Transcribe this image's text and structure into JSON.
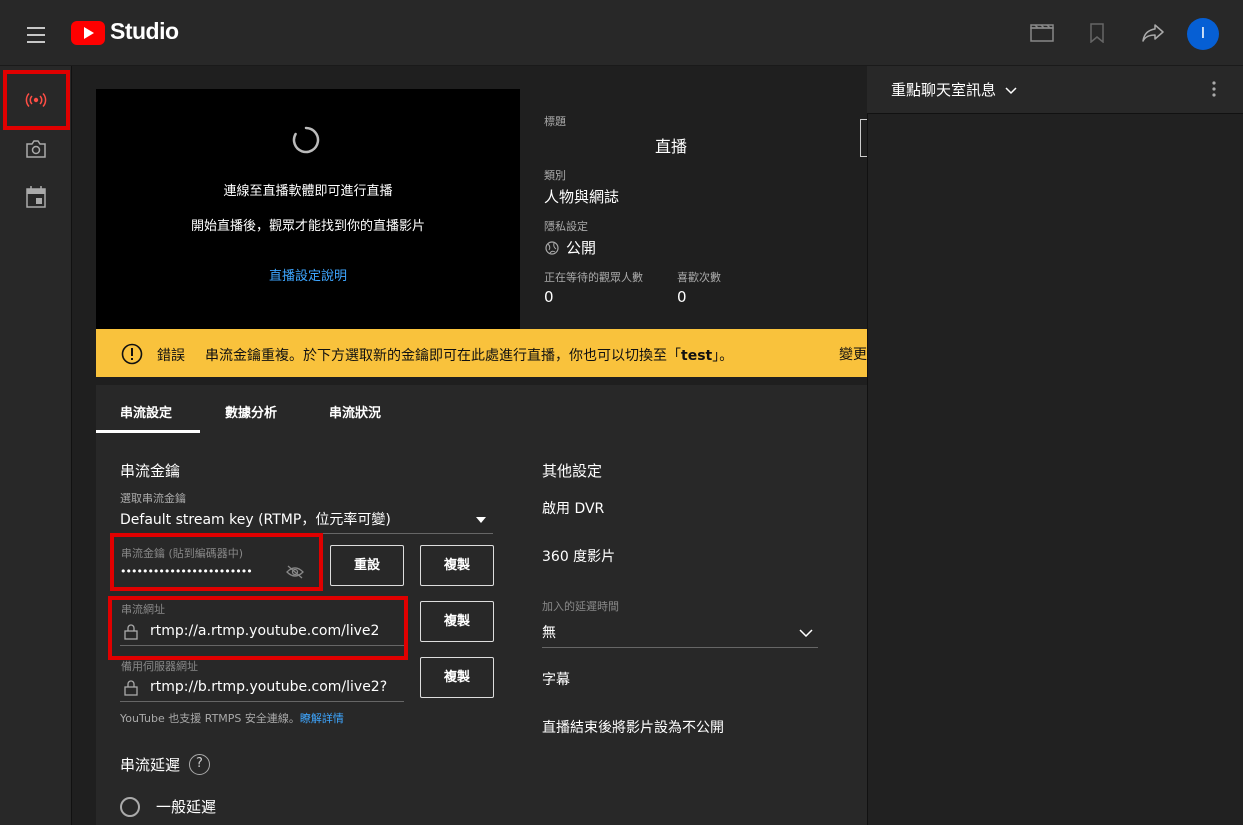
{
  "header": {
    "brand": "Studio",
    "avatar_letter": "I"
  },
  "preview": {
    "connect_text": "連線至直播軟體即可進行直播",
    "start_text": "開始直播後，觀眾才能找到你的直播影片",
    "help_link": "直播設定說明"
  },
  "info": {
    "title_label": "標題",
    "title_value": "直播",
    "category_label": "類別",
    "category_value": "人物與網誌",
    "privacy_label": "隱私設定",
    "privacy_value": "公開",
    "waiting_label": "正在等待的觀眾人數",
    "waiting_value": "0",
    "likes_label": "喜歡次數",
    "likes_value": "0"
  },
  "banner": {
    "error_label": "錯誤",
    "message": "串流金鑰重複。於下方選取新的金鑰即可在此處進行直播，你也可以切換至「",
    "key_name": "test",
    "message_end": "」。",
    "action": "變更"
  },
  "tabs": [
    {
      "label": "串流設定"
    },
    {
      "label": "數據分析"
    },
    {
      "label": "串流狀況"
    }
  ],
  "stream_key": {
    "section_title": "串流金鑰",
    "select_label": "選取串流金鑰",
    "select_value": "Default stream key (RTMP，位元率可變)",
    "key_label": "串流金鑰 (貼到編碼器中)",
    "key_value": "••••••••••••••••••••••••",
    "reset_label": "重設",
    "copy_label": "複製",
    "url_label": "串流網址",
    "url_value": "rtmp://a.rtmp.youtube.com/live2",
    "backup_label": "備用伺服器網址",
    "backup_value": "rtmp://b.rtmp.youtube.com/live2?",
    "rtmps_note": "YouTube 也支援 RTMPS 安全連線。",
    "rtmps_link": "瞭解詳情"
  },
  "latency": {
    "title": "串流延遲",
    "help": "?",
    "option_normal": "一般延遲"
  },
  "other": {
    "title": "其他設定",
    "dvr": "啟用 DVR",
    "vr360": "360 度影片",
    "delay_label": "加入的延遲時間",
    "delay_value": "無",
    "captions": "字幕",
    "unlist": "直播結束後將影片設為不公開"
  },
  "chat": {
    "title": "重點聊天室訊息"
  },
  "colors": {
    "accent_red": "#ff0000",
    "banner_yellow": "#f9c23c",
    "link_blue": "#3ea6ff",
    "avatar_blue": "#065fd4"
  }
}
